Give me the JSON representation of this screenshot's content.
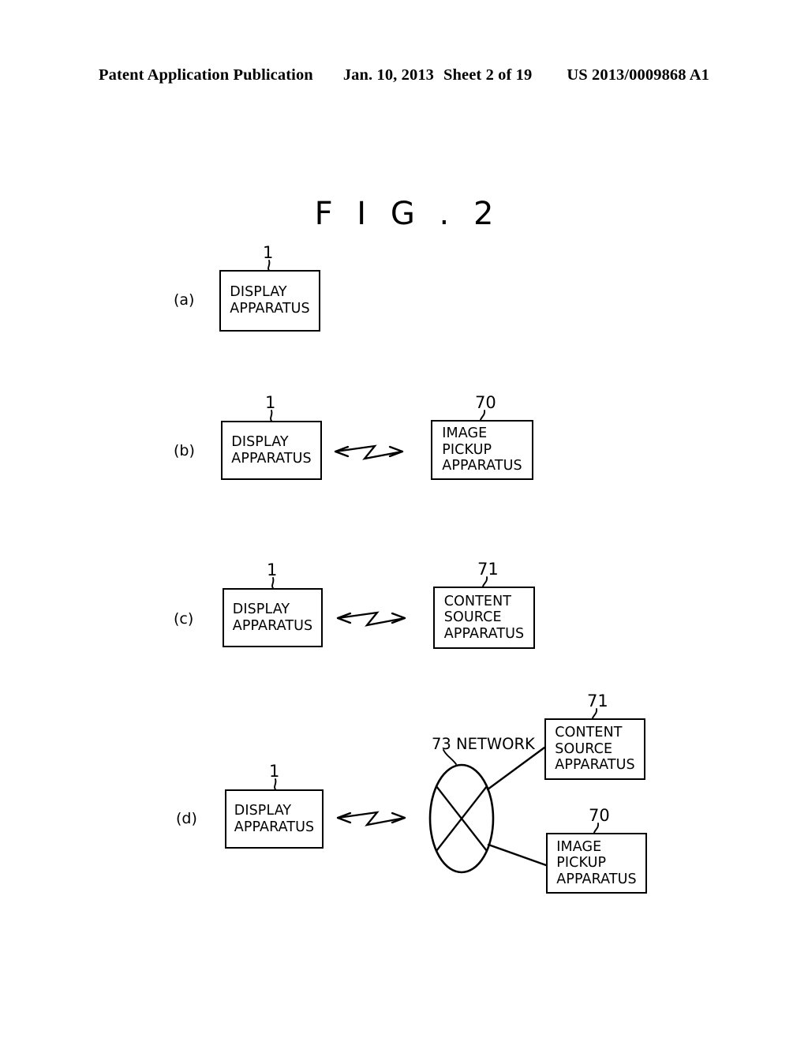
{
  "header": {
    "publication": "Patent Application Publication",
    "date": "Jan. 10, 2013",
    "sheet": "Sheet 2 of 19",
    "docnum": "US 2013/0009868 A1"
  },
  "figure": {
    "title": "F I G . 2"
  },
  "panels": {
    "a": {
      "label": "(a)",
      "display_box": "DISPLAY\nAPPARATUS",
      "display_ref": "1"
    },
    "b": {
      "label": "(b)",
      "display_box": "DISPLAY\nAPPARATUS",
      "display_ref": "1",
      "peer_box": "IMAGE\nPICKUP\nAPPARATUS",
      "peer_ref": "70",
      "link_icon": "wireless-zigzag-double-arrow"
    },
    "c": {
      "label": "(c)",
      "display_box": "DISPLAY\nAPPARATUS",
      "display_ref": "1",
      "peer_box": "CONTENT\nSOURCE\nAPPARATUS",
      "peer_ref": "71",
      "link_icon": "wireless-zigzag-double-arrow"
    },
    "d": {
      "label": "(d)",
      "display_box": "DISPLAY\nAPPARATUS",
      "display_ref": "1",
      "network_label": "73 NETWORK",
      "network_icon": "network-ellipse-cross",
      "content_box": "CONTENT\nSOURCE\nAPPARATUS",
      "content_ref": "71",
      "image_box": "IMAGE\nPICKUP\nAPPARATUS",
      "image_ref": "70",
      "link_icon": "wireless-zigzag-double-arrow"
    }
  },
  "style": {
    "ink": "#000000",
    "paper": "#ffffff"
  }
}
